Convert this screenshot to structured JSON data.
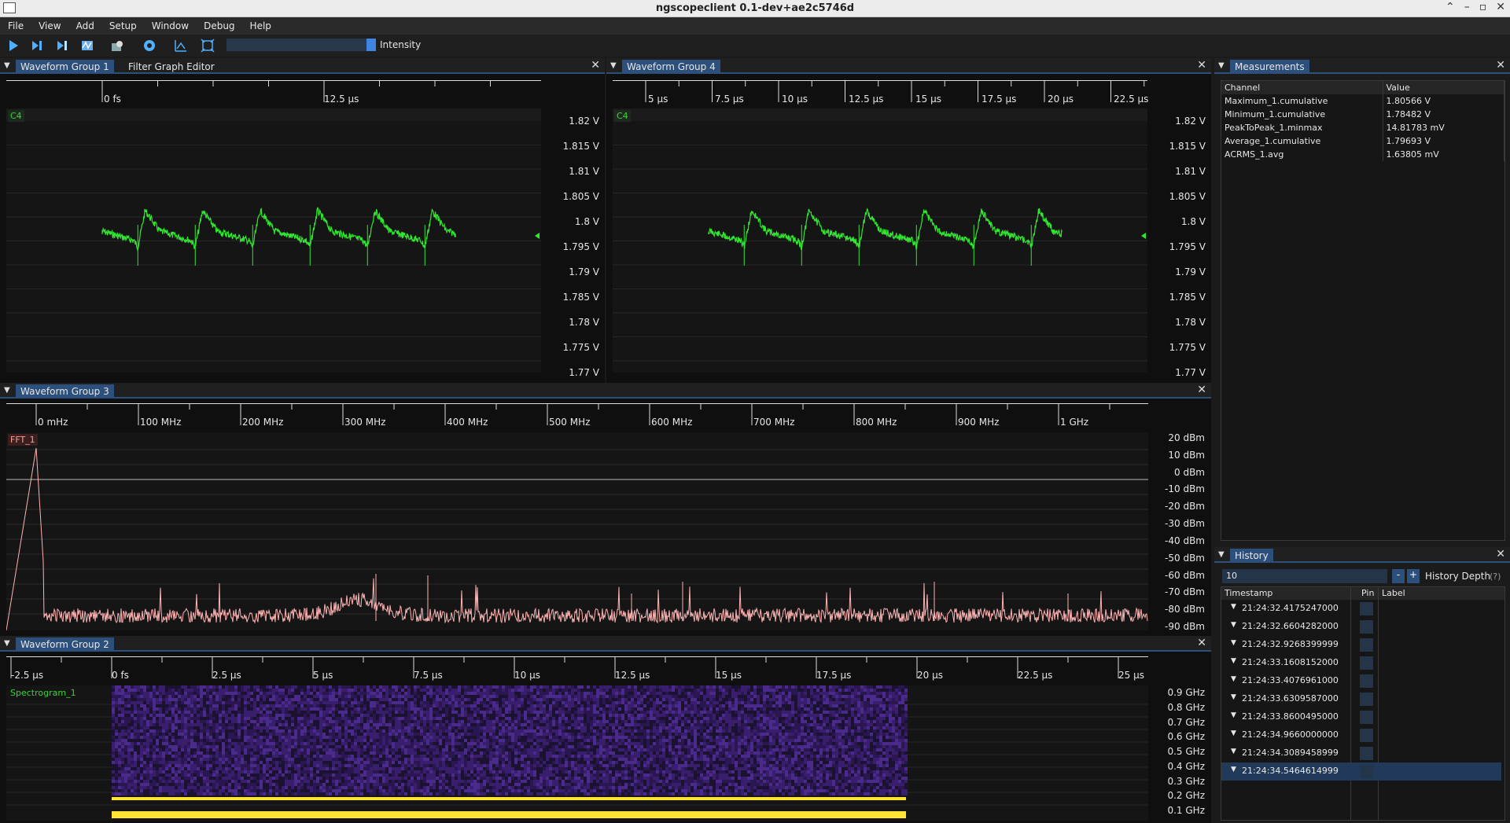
{
  "window": {
    "title": "ngscopeclient 0.1-dev+ae2c5746d",
    "controls": [
      "⌃",
      "–",
      "▫",
      "✕"
    ]
  },
  "menu": [
    "File",
    "View",
    "Add",
    "Setup",
    "Window",
    "Debug",
    "Help"
  ],
  "toolbar": {
    "icons": [
      "play-icon",
      "single-step-icon",
      "force-trigger-icon",
      "waveform-icon",
      "history-icon",
      "settings-icon",
      "add-filter-icon",
      "fullscreen-icon"
    ],
    "slider_label": "Intensity",
    "slider_fraction": 1.0
  },
  "colors": {
    "accent": "#2d4f7c",
    "waveform": "#2fe82f",
    "fft": "#ffb3b3",
    "spectrogram_band": "#ffe433"
  },
  "group1": {
    "tabs": [
      "Waveform Group 1",
      "Filter Graph Editor"
    ],
    "close": "✕",
    "ruler": [
      "0 fs",
      "12.5 µs"
    ],
    "channel": "C4",
    "yaxis": [
      "1.82 V",
      "1.815 V",
      "1.81 V",
      "1.805 V",
      "1.8 V",
      "1.795 V",
      "1.79 V",
      "1.785 V",
      "1.78 V",
      "1.775 V",
      "1.77 V"
    ]
  },
  "group4": {
    "tab": "Waveform Group 4",
    "close": "✕",
    "ruler": [
      "5 µs",
      "7.5 µs",
      "10 µs",
      "12.5 µs",
      "15 µs",
      "17.5 µs",
      "20 µs",
      "22.5 µs"
    ],
    "channel": "C4",
    "yaxis": [
      "1.82 V",
      "1.815 V",
      "1.81 V",
      "1.805 V",
      "1.8 V",
      "1.795 V",
      "1.79 V",
      "1.785 V",
      "1.78 V",
      "1.775 V",
      "1.77 V"
    ]
  },
  "group3": {
    "tab": "Waveform Group 3",
    "close": "✕",
    "ruler": [
      "0 mHz",
      "100 MHz",
      "200 MHz",
      "300 MHz",
      "400 MHz",
      "500 MHz",
      "600 MHz",
      "700 MHz",
      "800 MHz",
      "900 MHz",
      "1 GHz"
    ],
    "channel": "FFT_1",
    "yaxis": [
      "20 dBm",
      "10 dBm",
      "0 dBm",
      "-10 dBm",
      "-20 dBm",
      "-30 dBm",
      "-40 dBm",
      "-50 dBm",
      "-60 dBm",
      "-70 dBm",
      "-80 dBm",
      "-90 dBm"
    ]
  },
  "group2": {
    "tab": "Waveform Group 2",
    "close": "✕",
    "ruler": [
      "-2.5 µs",
      "0 fs",
      "2.5 µs",
      "5 µs",
      "7.5 µs",
      "10 µs",
      "12.5 µs",
      "15 µs",
      "17.5 µs",
      "20 µs",
      "22.5 µs",
      "25 µs"
    ],
    "channel": "Spectrogram_1",
    "yaxis": [
      "0.9 GHz",
      "0.8 GHz",
      "0.7 GHz",
      "0.6 GHz",
      "0.5 GHz",
      "0.4 GHz",
      "0.3 GHz",
      "0.2 GHz",
      "0.1 GHz"
    ]
  },
  "measurements": {
    "tab": "Measurements",
    "close": "✕",
    "headers": [
      "Channel",
      "Value"
    ],
    "rows": [
      [
        "Maximum_1.cumulative",
        "1.80566 V"
      ],
      [
        "Minimum_1.cumulative",
        "1.78482 V"
      ],
      [
        "PeakToPeak_1.minmax",
        "14.81783 mV"
      ],
      [
        "Average_1.cumulative",
        "1.79693 V"
      ],
      [
        "ACRMS_1.avg",
        "1.63805 mV"
      ]
    ]
  },
  "history": {
    "tab": "History",
    "close": "✕",
    "depth_value": "10",
    "minus": "-",
    "plus": "+",
    "depth_label": "History Depth",
    "help": "(?)",
    "headers": [
      "Timestamp",
      "Pin",
      "Label"
    ],
    "rows": [
      "21:24:32.4175247000",
      "21:24:32.6604282000",
      "21:24:32.9268399999",
      "21:24:33.1608152000",
      "21:24:33.4076961000",
      "21:24:33.6309587000",
      "21:24:33.8600495000",
      "21:24:34.9660000000",
      "21:24:34.3089458999",
      "21:24:34.5464614999"
    ],
    "selected_index": 9
  }
}
